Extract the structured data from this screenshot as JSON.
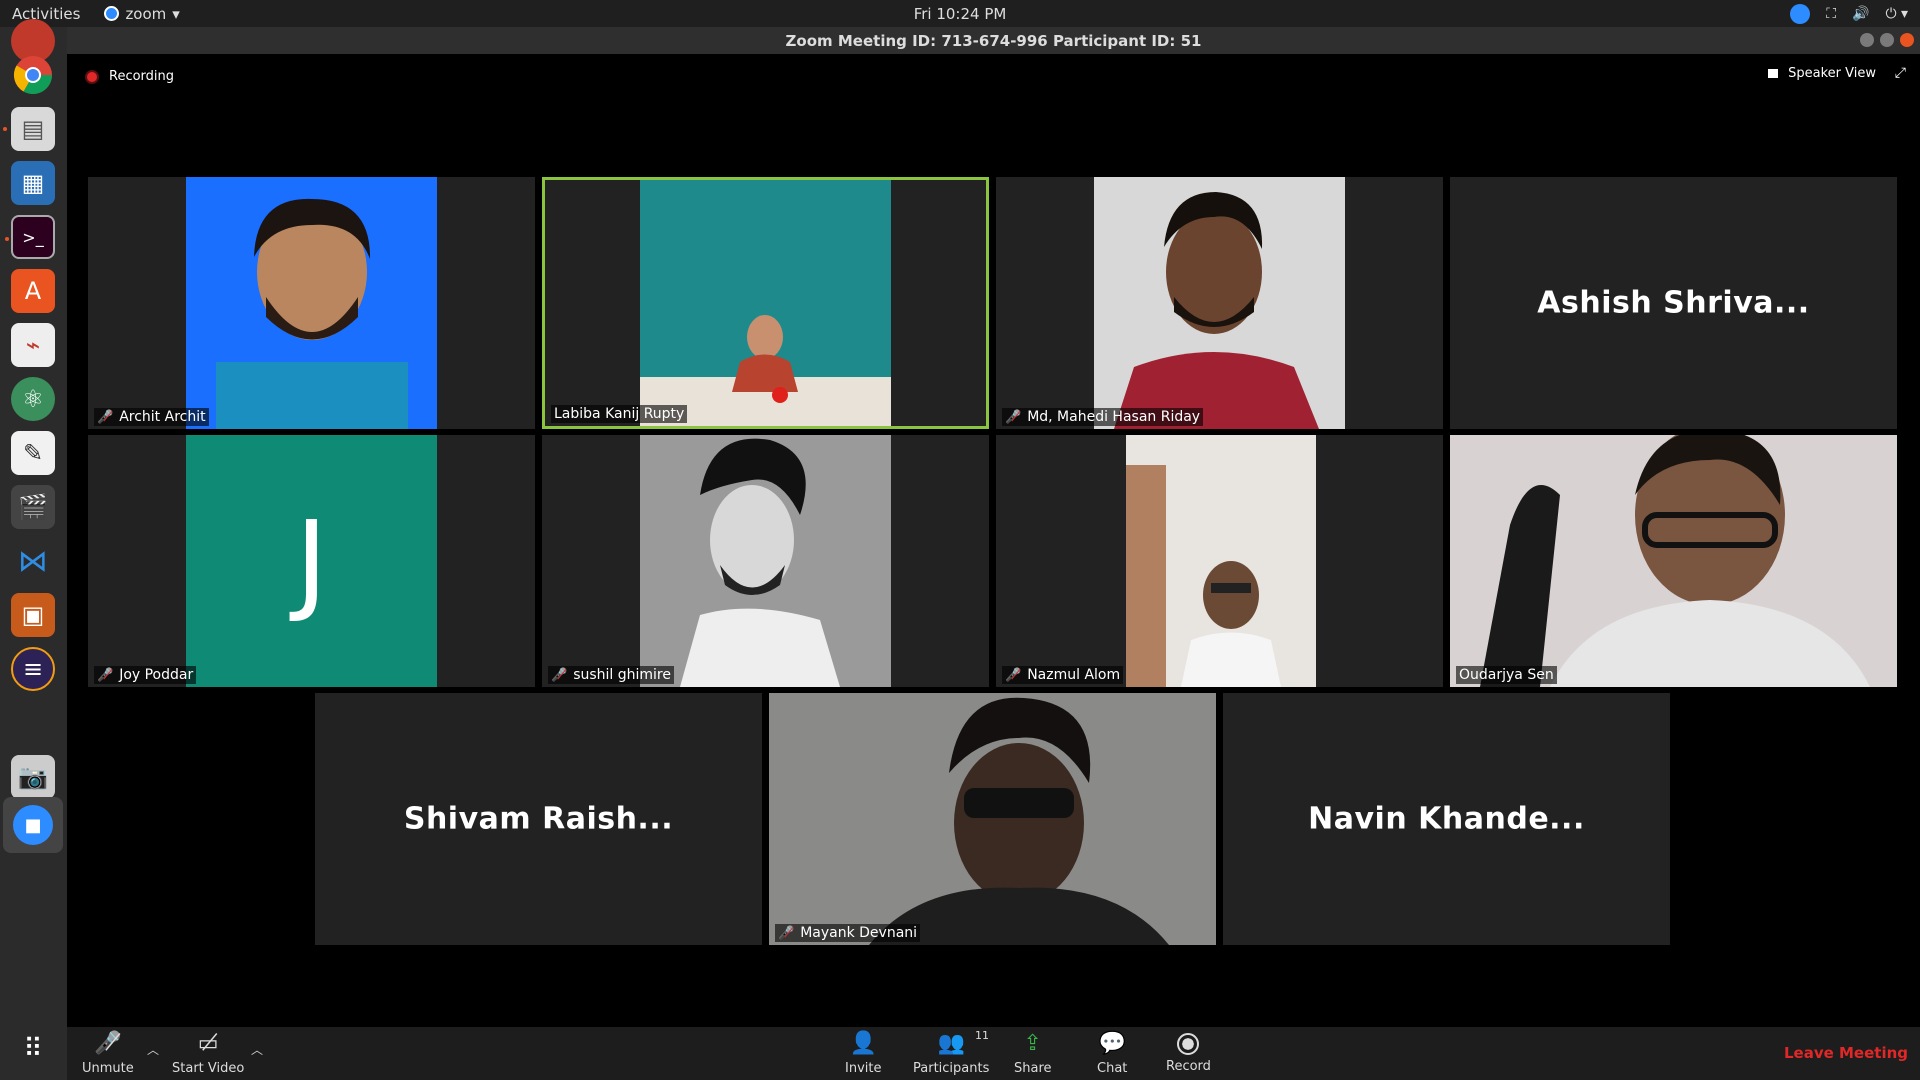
{
  "topbar": {
    "activities": "Activities",
    "app_name": "zoom",
    "app_menu_arrow": "▾",
    "clock": "Fri 10:24 PM",
    "tray_icons": [
      "zoom-icon",
      "network-icon",
      "volume-icon",
      "power-icon"
    ]
  },
  "dock": {
    "items": [
      "firefox",
      "chrome",
      "files",
      "text-document",
      "terminal",
      "software-center",
      "pdf-reader",
      "atom",
      "text-editor",
      "video-editor",
      "vscode",
      "presentation",
      "eclipse",
      "camera",
      "zoom",
      "app-grid"
    ]
  },
  "window": {
    "title": "Zoom Meeting ID: 713-674-996 Participant ID: 51"
  },
  "meeting": {
    "recording_label": "Recording",
    "view_label": "Speaker View",
    "participants": [
      {
        "name": "Archit Archit",
        "muted": true,
        "video": true,
        "bg": "#1a6fff"
      },
      {
        "name": "Labiba Kanij Rupty",
        "muted": false,
        "video": true,
        "active": true,
        "bg": "#1f8a8c"
      },
      {
        "name": "Md, Mahedi Hasan Riday",
        "muted": true,
        "video": true,
        "bg": "#d8d8d8"
      },
      {
        "name": "Ashish Shriva...",
        "muted": false,
        "video": false
      },
      {
        "name": "Joy Poddar",
        "muted": true,
        "video": false,
        "avatar_letter": "J"
      },
      {
        "name": "sushil ghimire",
        "muted": true,
        "video": true,
        "bg": "#9a9a9a"
      },
      {
        "name": "Nazmul Alom",
        "muted": true,
        "video": true,
        "bg": "#e8e4df"
      },
      {
        "name": "Oudarjya Sen",
        "muted": false,
        "video": true,
        "bg": "#d9d2d3"
      },
      {
        "name": "Shivam Raish...",
        "muted": false,
        "video": false
      },
      {
        "name": "Mayank Devnani",
        "muted": true,
        "video": true,
        "bg": "#6a6a6a"
      },
      {
        "name": "Navin Khande...",
        "muted": false,
        "video": false
      }
    ]
  },
  "toolbar": {
    "unmute": "Unmute",
    "start_video": "Start Video",
    "invite": "Invite",
    "participants": "Participants",
    "participants_count": "11",
    "share": "Share",
    "chat": "Chat",
    "record": "Record",
    "leave": "Leave Meeting"
  },
  "colors": {
    "active_speaker_border": "#8bc53f",
    "leave": "#e02828",
    "share": "#3ab54a",
    "zoom_blue": "#2d8cff"
  }
}
